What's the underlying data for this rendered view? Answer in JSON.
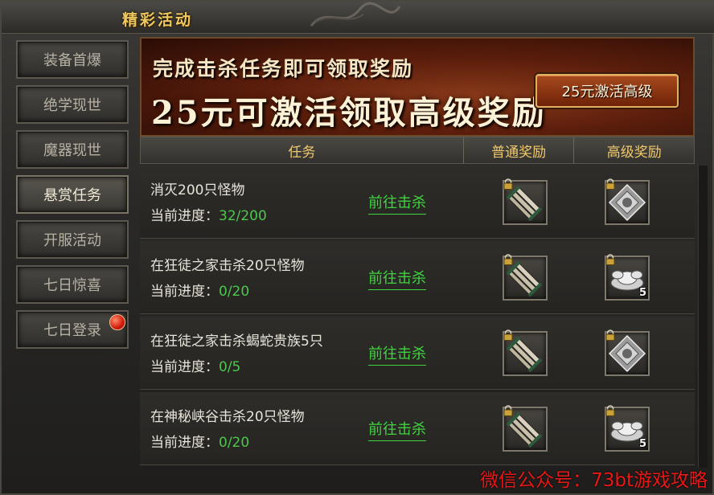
{
  "window": {
    "title": "精彩活动"
  },
  "sidebar": {
    "items": [
      {
        "label": "装备首爆"
      },
      {
        "label": "绝学现世"
      },
      {
        "label": "魔器现世"
      },
      {
        "label": "悬赏任务",
        "active": true
      },
      {
        "label": "开服活动"
      },
      {
        "label": "七日惊喜"
      },
      {
        "label": "七日登录",
        "has_badge": true
      }
    ]
  },
  "banner": {
    "line1": "完成击杀任务即可领取奖励",
    "line2": "25元可激活领取高级奖励",
    "activate_label": "25元激活高级"
  },
  "table": {
    "headers": {
      "task": "任务",
      "normal_reward": "普通奖励",
      "advanced_reward": "高级奖励"
    },
    "progress_label": "当前进度：",
    "rows": [
      {
        "task": "消灭200只怪物",
        "progress": "32/200",
        "action": "前往击杀",
        "normal_icon": "scroll-bundle-icon",
        "advanced_icon": "silver-gem-cube-icon",
        "advanced_count": ""
      },
      {
        "task": "在狂徒之家击杀20只怪物",
        "progress": "0/20",
        "action": "前往击杀",
        "normal_icon": "scroll-bundle-icon",
        "advanced_icon": "silver-ingot-icon",
        "advanced_count": "5"
      },
      {
        "task": "在狂徒之家击杀蝎蛇贵族5只",
        "progress": "0/5",
        "action": "前往击杀",
        "normal_icon": "scroll-bundle-icon",
        "advanced_icon": "silver-gem-cube-icon",
        "advanced_count": ""
      },
      {
        "task": "在神秘峡谷击杀20只怪物",
        "progress": "0/20",
        "action": "前往击杀",
        "normal_icon": "scroll-bundle-icon",
        "advanced_icon": "silver-ingot-icon",
        "advanced_count": "5"
      }
    ]
  },
  "watermark": "微信公众号：73bt游戏攻略",
  "colors": {
    "title_gold": "#f0c860",
    "progress_green": "#4ec64e",
    "action_green": "#3fd43f",
    "watermark_red": "#e81818"
  }
}
